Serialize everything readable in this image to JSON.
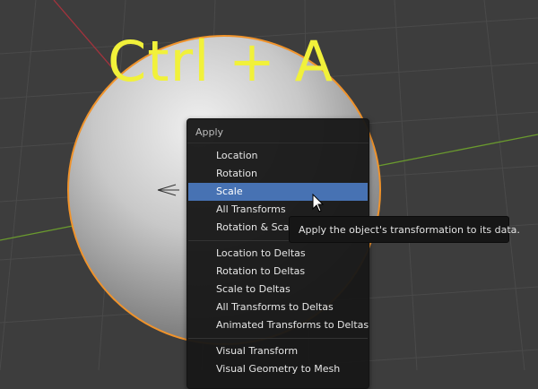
{
  "overlay": {
    "shortcut": "Ctrl + A"
  },
  "menu": {
    "title": "Apply",
    "items": [
      "Location",
      "Rotation",
      "Scale",
      "All Transforms",
      "Rotation & Scale",
      "Location to Deltas",
      "Rotation to Deltas",
      "Scale to Deltas",
      "All Transforms to Deltas",
      "Animated Transforms to Deltas",
      "Visual Transform",
      "Visual Geometry to Mesh"
    ],
    "active_item": "Scale"
  },
  "tooltip": {
    "text": "Apply the object's transformation to its data."
  },
  "colors": {
    "viewport_bg": "#3d3d3d",
    "grid": "#4a4a4a",
    "x_axis": "#a3333d",
    "y_axis": "#6a9a2e",
    "selection_outline": "#f0932b",
    "overlay_text": "#f1f13a",
    "menu_highlight": "#4772b3"
  }
}
